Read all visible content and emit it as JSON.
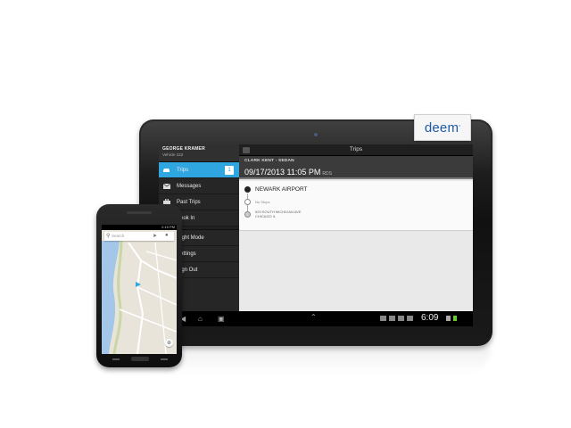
{
  "brand": {
    "name": "deem",
    "mark": "°"
  },
  "tablet": {
    "user": {
      "name": "GEORGE KRAMER",
      "vehicle": "Vehicle 222"
    },
    "nav": [
      {
        "label": "Trips",
        "icon": "car-icon",
        "badge": "1",
        "active": true
      },
      {
        "label": "Messages",
        "icon": "envelope-icon"
      },
      {
        "label": "Past Trips",
        "icon": "briefcase-icon"
      },
      {
        "label": "Book In",
        "icon": "book-icon"
      },
      {
        "label": "Night Mode",
        "icon": "moon-icon"
      },
      {
        "label": "Settings",
        "icon": "gear-icon"
      },
      {
        "label": "Sign Out",
        "icon": "logout-icon"
      }
    ],
    "title": "Trips",
    "trip": {
      "passenger": "CLARK KENT - SEDAN",
      "datetime": "09/17/2013 11:05 PM",
      "code": "RDS",
      "pickup": "NEWARK AIRPORT",
      "stops": "No Stops",
      "dropoff_line1": "520 SOUTH MICHIGAN AVE",
      "dropoff_line2": "CHICAGO IL"
    },
    "system": {
      "time": "6:09"
    }
  },
  "phone": {
    "status_time": "2:15 PM",
    "search_placeholder": "Search",
    "map_labels": [
      "Smith St",
      "Wharf St",
      "Lock St"
    ],
    "colors": {
      "water": "#a4c6e8",
      "land": "#e8e4da",
      "road": "#ffffff",
      "location": "#2fa6e0"
    }
  }
}
